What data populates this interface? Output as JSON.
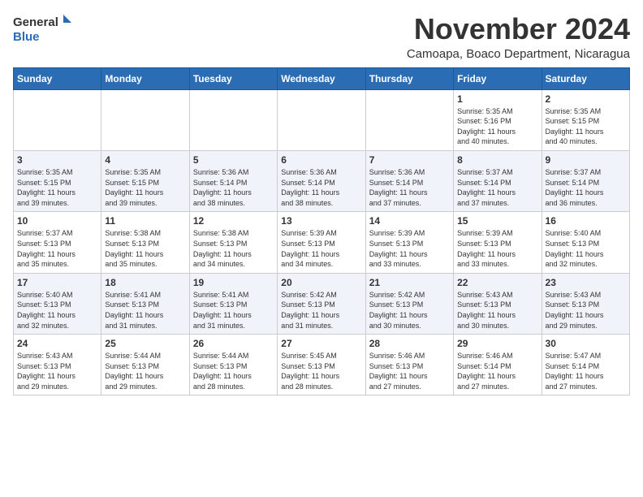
{
  "logo": {
    "general": "General",
    "blue": "Blue"
  },
  "header": {
    "month": "November 2024",
    "location": "Camoapa, Boaco Department, Nicaragua"
  },
  "weekdays": [
    "Sunday",
    "Monday",
    "Tuesday",
    "Wednesday",
    "Thursday",
    "Friday",
    "Saturday"
  ],
  "weeks": [
    [
      {
        "day": "",
        "info": ""
      },
      {
        "day": "",
        "info": ""
      },
      {
        "day": "",
        "info": ""
      },
      {
        "day": "",
        "info": ""
      },
      {
        "day": "",
        "info": ""
      },
      {
        "day": "1",
        "info": "Sunrise: 5:35 AM\nSunset: 5:16 PM\nDaylight: 11 hours\nand 40 minutes."
      },
      {
        "day": "2",
        "info": "Sunrise: 5:35 AM\nSunset: 5:15 PM\nDaylight: 11 hours\nand 40 minutes."
      }
    ],
    [
      {
        "day": "3",
        "info": "Sunrise: 5:35 AM\nSunset: 5:15 PM\nDaylight: 11 hours\nand 39 minutes."
      },
      {
        "day": "4",
        "info": "Sunrise: 5:35 AM\nSunset: 5:15 PM\nDaylight: 11 hours\nand 39 minutes."
      },
      {
        "day": "5",
        "info": "Sunrise: 5:36 AM\nSunset: 5:14 PM\nDaylight: 11 hours\nand 38 minutes."
      },
      {
        "day": "6",
        "info": "Sunrise: 5:36 AM\nSunset: 5:14 PM\nDaylight: 11 hours\nand 38 minutes."
      },
      {
        "day": "7",
        "info": "Sunrise: 5:36 AM\nSunset: 5:14 PM\nDaylight: 11 hours\nand 37 minutes."
      },
      {
        "day": "8",
        "info": "Sunrise: 5:37 AM\nSunset: 5:14 PM\nDaylight: 11 hours\nand 37 minutes."
      },
      {
        "day": "9",
        "info": "Sunrise: 5:37 AM\nSunset: 5:14 PM\nDaylight: 11 hours\nand 36 minutes."
      }
    ],
    [
      {
        "day": "10",
        "info": "Sunrise: 5:37 AM\nSunset: 5:13 PM\nDaylight: 11 hours\nand 35 minutes."
      },
      {
        "day": "11",
        "info": "Sunrise: 5:38 AM\nSunset: 5:13 PM\nDaylight: 11 hours\nand 35 minutes."
      },
      {
        "day": "12",
        "info": "Sunrise: 5:38 AM\nSunset: 5:13 PM\nDaylight: 11 hours\nand 34 minutes."
      },
      {
        "day": "13",
        "info": "Sunrise: 5:39 AM\nSunset: 5:13 PM\nDaylight: 11 hours\nand 34 minutes."
      },
      {
        "day": "14",
        "info": "Sunrise: 5:39 AM\nSunset: 5:13 PM\nDaylight: 11 hours\nand 33 minutes."
      },
      {
        "day": "15",
        "info": "Sunrise: 5:39 AM\nSunset: 5:13 PM\nDaylight: 11 hours\nand 33 minutes."
      },
      {
        "day": "16",
        "info": "Sunrise: 5:40 AM\nSunset: 5:13 PM\nDaylight: 11 hours\nand 32 minutes."
      }
    ],
    [
      {
        "day": "17",
        "info": "Sunrise: 5:40 AM\nSunset: 5:13 PM\nDaylight: 11 hours\nand 32 minutes."
      },
      {
        "day": "18",
        "info": "Sunrise: 5:41 AM\nSunset: 5:13 PM\nDaylight: 11 hours\nand 31 minutes."
      },
      {
        "day": "19",
        "info": "Sunrise: 5:41 AM\nSunset: 5:13 PM\nDaylight: 11 hours\nand 31 minutes."
      },
      {
        "day": "20",
        "info": "Sunrise: 5:42 AM\nSunset: 5:13 PM\nDaylight: 11 hours\nand 31 minutes."
      },
      {
        "day": "21",
        "info": "Sunrise: 5:42 AM\nSunset: 5:13 PM\nDaylight: 11 hours\nand 30 minutes."
      },
      {
        "day": "22",
        "info": "Sunrise: 5:43 AM\nSunset: 5:13 PM\nDaylight: 11 hours\nand 30 minutes."
      },
      {
        "day": "23",
        "info": "Sunrise: 5:43 AM\nSunset: 5:13 PM\nDaylight: 11 hours\nand 29 minutes."
      }
    ],
    [
      {
        "day": "24",
        "info": "Sunrise: 5:43 AM\nSunset: 5:13 PM\nDaylight: 11 hours\nand 29 minutes."
      },
      {
        "day": "25",
        "info": "Sunrise: 5:44 AM\nSunset: 5:13 PM\nDaylight: 11 hours\nand 29 minutes."
      },
      {
        "day": "26",
        "info": "Sunrise: 5:44 AM\nSunset: 5:13 PM\nDaylight: 11 hours\nand 28 minutes."
      },
      {
        "day": "27",
        "info": "Sunrise: 5:45 AM\nSunset: 5:13 PM\nDaylight: 11 hours\nand 28 minutes."
      },
      {
        "day": "28",
        "info": "Sunrise: 5:46 AM\nSunset: 5:13 PM\nDaylight: 11 hours\nand 27 minutes."
      },
      {
        "day": "29",
        "info": "Sunrise: 5:46 AM\nSunset: 5:14 PM\nDaylight: 11 hours\nand 27 minutes."
      },
      {
        "day": "30",
        "info": "Sunrise: 5:47 AM\nSunset: 5:14 PM\nDaylight: 11 hours\nand 27 minutes."
      }
    ]
  ]
}
